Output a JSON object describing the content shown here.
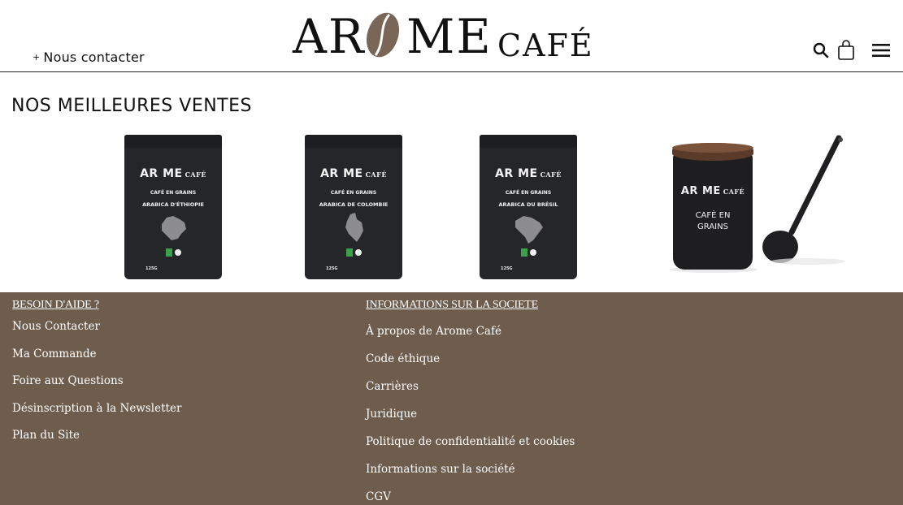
{
  "header": {
    "contact_label": "Nous contacter",
    "contact_prefix": "+",
    "logo": {
      "left_text": "AR",
      "right_text": "ME",
      "suffix": "CAFÉ"
    },
    "icons": [
      "search-icon",
      "cart-icon",
      "menu-icon"
    ]
  },
  "section": {
    "title": "NOS MEILLEURES VENTES"
  },
  "products": [
    {
      "brand": "AR ME",
      "brand_small": "CAFÉ",
      "line1": "CAFÉ EN GRAINS",
      "line2": "ARABICA D'ÉTHIOPIE",
      "weight": "125G"
    },
    {
      "brand": "AR ME",
      "brand_small": "CAFÉ",
      "line1": "CAFÉ EN GRAINS",
      "line2": "ARABICA DE COLOMBIE",
      "weight": "125G"
    },
    {
      "brand": "AR ME",
      "brand_small": "CAFÉ",
      "line1": "CAFÉ EN GRAINS",
      "line2": "ARABICA DU BRÉSIL",
      "weight": "125G"
    },
    {
      "brand": "AR ME",
      "brand_small": "CAFÉ",
      "line1": "CAFÈ EN",
      "line2": "GRAINS"
    }
  ],
  "footer": {
    "col1": {
      "heading": "BESOIN D'AIDE ?",
      "links": [
        "Nous Contacter",
        "Ma Commande",
        "Foire aux Questions",
        "Désinscription à la Newsletter",
        "Plan du Site"
      ]
    },
    "col2": {
      "heading": "INFORMATIONS SUR LA SOCIETE",
      "links": [
        "À propos de Arome Café",
        "Code éthique",
        "Carrières",
        "Juridique",
        "Politique de confidentialité et cookies",
        "Informations sur la société",
        "CGV"
      ]
    }
  },
  "colors": {
    "footer_bg": "#6e5c4d",
    "bean": "#7a6656",
    "bag": "#25262a"
  }
}
